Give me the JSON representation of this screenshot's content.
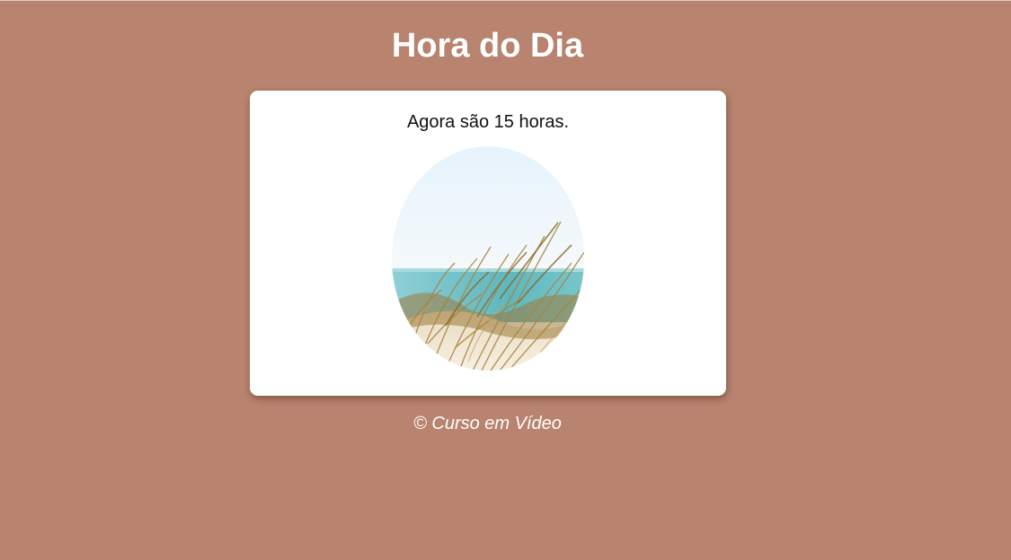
{
  "header": {
    "title": "Hora do Dia"
  },
  "card": {
    "message": "Agora são 15 horas.",
    "image": {
      "subject": "beach-dune-grass",
      "shape": "oval"
    }
  },
  "footer": {
    "text": "© Curso em Vídeo"
  },
  "colors": {
    "background": "#b8836f",
    "card": "#ffffff",
    "title": "#ffffff",
    "sky": "#eef6fb",
    "sea": "#7fc4c9",
    "sand": "#f1e6d2",
    "grass": "#a9853f"
  }
}
